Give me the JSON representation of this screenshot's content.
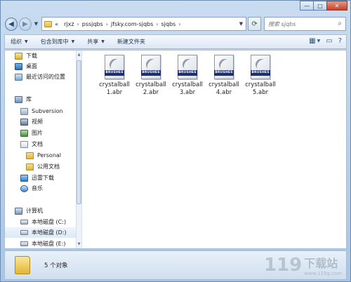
{
  "window": {
    "controls": [
      "—",
      "□",
      "✕"
    ]
  },
  "address": {
    "prefix": "«",
    "crumbs": [
      "rjxz",
      "pssjqbs",
      "jfsky.com-sjqbs",
      "sjqbs"
    ],
    "separator": "›"
  },
  "search": {
    "placeholder": "搜索 sjqbs"
  },
  "toolbar": {
    "organize": "组织",
    "include_in_library": "包含到库中",
    "share": "共享",
    "new_folder": "新建文件夹"
  },
  "nav": {
    "items": [
      {
        "label": "下载",
        "icon": "downloads-folder-icon"
      },
      {
        "label": "桌面",
        "icon": "desktop-icon"
      },
      {
        "label": "最近访问的位置",
        "icon": "recent-places-icon"
      },
      {
        "label": "库",
        "icon": "libraries-icon"
      },
      {
        "label": "Subversion",
        "icon": "subversion-icon"
      },
      {
        "label": "视频",
        "icon": "videos-icon"
      },
      {
        "label": "图片",
        "icon": "pictures-icon"
      },
      {
        "label": "文档",
        "icon": "documents-icon"
      },
      {
        "label": "Personal",
        "icon": "folder-icon"
      },
      {
        "label": "公用文档",
        "icon": "folder-icon"
      },
      {
        "label": "迅雷下载",
        "icon": "thunder-download-icon"
      },
      {
        "label": "音乐",
        "icon": "music-icon"
      },
      {
        "label": "计算机",
        "icon": "computer-icon"
      },
      {
        "label": "本地磁盘 (C:)",
        "icon": "drive-icon"
      },
      {
        "label": "本地磁盘 (D:)",
        "icon": "drive-icon"
      },
      {
        "label": "本地磁盘 (E:)",
        "icon": "drive-icon"
      }
    ]
  },
  "files": [
    {
      "name": "crystalball1.abr",
      "badge": "BRUSHES"
    },
    {
      "name": "crystalball2.abr",
      "badge": "BRUSHES"
    },
    {
      "name": "crystalball3.abr",
      "badge": "BRUSHES"
    },
    {
      "name": "crystalball4.abr",
      "badge": "BRUSHES"
    },
    {
      "name": "crystalball5.abr",
      "badge": "BRUSHES"
    }
  ],
  "status": {
    "count_text": "5 个对象"
  },
  "watermark": {
    "num": "119",
    "cn": "下载站",
    "url": "www.119g.com"
  }
}
